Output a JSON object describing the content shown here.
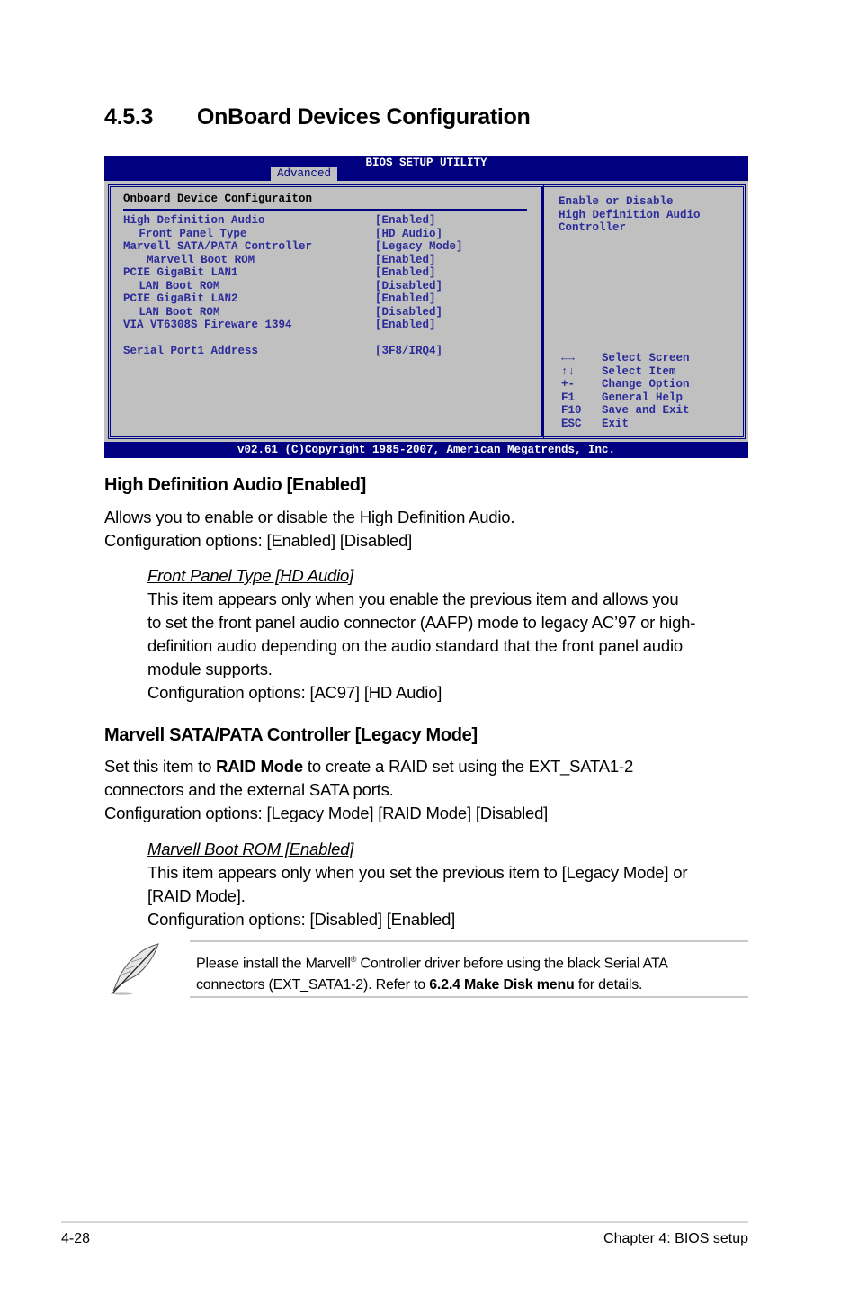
{
  "section": {
    "number": "4.5.3",
    "title": "OnBoard Devices Configuration"
  },
  "bios": {
    "title": "BIOS SETUP UTILITY",
    "active_tab": "Advanced",
    "menu_heading": "Onboard Device Configuraiton",
    "items": [
      {
        "label": "High Definition Audio",
        "value": "[Enabled]",
        "indent": 0
      },
      {
        "label": "Front Panel Type",
        "value": "[HD Audio]",
        "indent": 2
      },
      {
        "label": "Marvell SATA/PATA Controller",
        "value": "[Legacy Mode]",
        "indent": 0
      },
      {
        "label": "Marvell Boot ROM",
        "value": "[Enabled]",
        "indent": 3
      },
      {
        "label": "PCIE GigaBit LAN1",
        "value": "[Enabled]",
        "indent": 0
      },
      {
        "label": "LAN Boot ROM",
        "value": "[Disabled]",
        "indent": 2
      },
      {
        "label": "PCIE GigaBit LAN2",
        "value": "[Enabled]",
        "indent": 0
      },
      {
        "label": "LAN Boot ROM",
        "value": "[Disabled]",
        "indent": 2
      },
      {
        "label": "VIA VT6308S Fireware 1394",
        "value": "[Enabled]",
        "indent": 0
      },
      {
        "label": "",
        "value": "",
        "indent": 0
      },
      {
        "label": "Serial Port1 Address",
        "value": "[3F8/IRQ4]",
        "indent": 0
      }
    ],
    "help": [
      "Enable or Disable",
      "High Definition Audio",
      "Controller"
    ],
    "keys": [
      {
        "key": "←→",
        "icon": "left-right-arrows-icon",
        "desc": "Select Screen"
      },
      {
        "key": "↑↓",
        "icon": "up-down-arrows-icon",
        "desc": "Select Item"
      },
      {
        "key": "+-",
        "desc": "Change Option"
      },
      {
        "key": "F1",
        "desc": "General Help"
      },
      {
        "key": "F10",
        "desc": "Save and Exit"
      },
      {
        "key": "ESC",
        "desc": "Exit"
      }
    ],
    "footer": "v02.61 (C)Copyright 1985-2007, American Megatrends, Inc.",
    "colors": {
      "frame": "#000080",
      "panel": "#c0c0c0",
      "text": "#2b2b9a"
    }
  },
  "hda": {
    "heading": "High Definition Audio [Enabled]",
    "lines": [
      "Allows you to enable or disable the High Definition Audio.",
      "Configuration options: [Enabled] [Disabled]"
    ],
    "sub": {
      "title": "Front Panel Type [HD Audio]",
      "lines": [
        "This item appears only when you enable the previous item and allows you",
        "to set the front panel audio connector (AAFP) mode to legacy AC’97 or high-",
        "definition audio depending on the audio standard that the front panel audio",
        "module supports.",
        "Configuration options: [AC97] [HD Audio]"
      ]
    }
  },
  "marvell": {
    "heading": "Marvell SATA/PATA Controller [Legacy Mode]",
    "line1_pre": "Set this item to ",
    "line1_bold": "RAID Mode",
    "line1_post": " to create a RAID set using the EXT_SATA1-2",
    "line2": "connectors and the external SATA ports.",
    "line3": "Configuration options: [Legacy Mode] [RAID Mode] [Disabled]",
    "sub": {
      "title": "Marvell Boot ROM [Enabled]",
      "lines": [
        "This item appears only when you set the previous item to [Legacy Mode] or",
        "[RAID Mode].",
        "Configuration options: [Disabled] [Enabled]"
      ]
    }
  },
  "note": {
    "icon": "feather-quill-icon",
    "line1_pre": "Please install the Marvell",
    "line1_sup": "®",
    "line1_post": " Controller driver before using the black Serial ATA",
    "line2_pre": "connectors (EXT_SATA1-2). Refer to ",
    "line2_bold": "6.2.4 Make Disk menu",
    "line2_post": " for details."
  },
  "footer": {
    "page": "4-28",
    "chapter": "Chapter 4: BIOS setup"
  }
}
